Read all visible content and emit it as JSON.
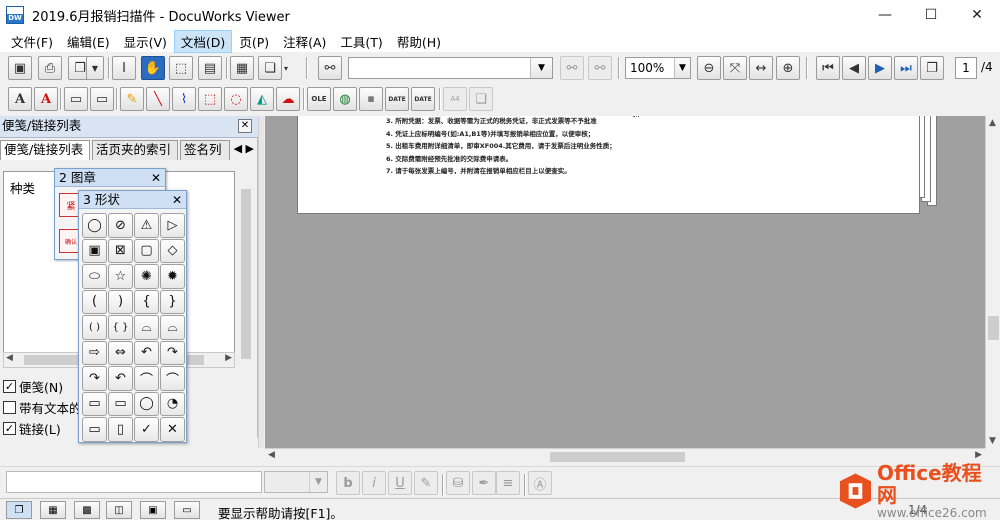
{
  "window": {
    "title": "2019.6月报销扫描件 - DocuWorks Viewer",
    "app_icon_text": "DW",
    "minimize": "—",
    "maximize": "☐",
    "close": "✕"
  },
  "menu": [
    {
      "label": "文件(F)"
    },
    {
      "label": "编辑(E)"
    },
    {
      "label": "显示(V)"
    },
    {
      "label": "文档(D)"
    },
    {
      "label": "页(P)"
    },
    {
      "label": "注释(A)"
    },
    {
      "label": "工具(T)"
    },
    {
      "label": "帮助(H)"
    }
  ],
  "toolbar": {
    "search_value": "",
    "zoom_value": "100%",
    "page_current": "1",
    "page_total": "/4",
    "text_a_black": "A",
    "text_a_red": "A",
    "stamp_labels": [
      "OLE",
      "DATE",
      "DATE"
    ],
    "a4_label": "A4"
  },
  "left_panel": {
    "title": "便笺/链接列表",
    "close": "✕",
    "tabs": [
      "便笺/链接列表",
      "活页夹的索引",
      "签名列"
    ],
    "tab_arrows": "◀ ▶",
    "kind_label": "种类",
    "checkboxes": [
      {
        "label": "便笺(N)",
        "checked": "✓"
      },
      {
        "label": "带有文本的",
        "checked": ""
      },
      {
        "label": "链接(L)",
        "checked": "✓"
      }
    ]
  },
  "stamp_palette": {
    "title": "2 图章",
    "close": "✕",
    "items": [
      "紧",
      "确认"
    ]
  },
  "shape_palette": {
    "title": "3 形状",
    "close": "✕",
    "shapes": [
      "◯",
      "⊘",
      "⚠",
      "▷",
      "▣",
      "⊠",
      "▢",
      "◇",
      "⬭",
      "☆",
      "✺",
      "✹",
      "(",
      ")",
      "{",
      "}",
      "( )",
      "{ }",
      "⌓",
      "⌓",
      "⇨",
      "⇔",
      "↶",
      "↷",
      "↷",
      "↶",
      "⌒",
      "⌒",
      "▭",
      "▭",
      "◯",
      "◔",
      "▭",
      "▯",
      "✓",
      "✕"
    ]
  },
  "document": {
    "lines": [
      "3.  所附凭据：发票、收据等需为正式的税务凭证，非正式发票等不予批准",
      "4.  凭证上应标明编号(如:A1,B1等)并填写报销单相应位置，以便审核；",
      "5.  出租车费用附详细清单，即审XF004.其它费用，请于发票后注明业务性质；",
      "6.  交际费需附经预先批准的交际费申请表。",
      "7.  请于每张发票上编号，并附清在报销单相应栏目上以便查实。"
    ]
  },
  "status": {
    "help_text": "要显示帮助请按[F1]。",
    "page_indicator": "1/4"
  },
  "watermark": {
    "line1": "Office教程网",
    "line2": "www.office26.com"
  }
}
